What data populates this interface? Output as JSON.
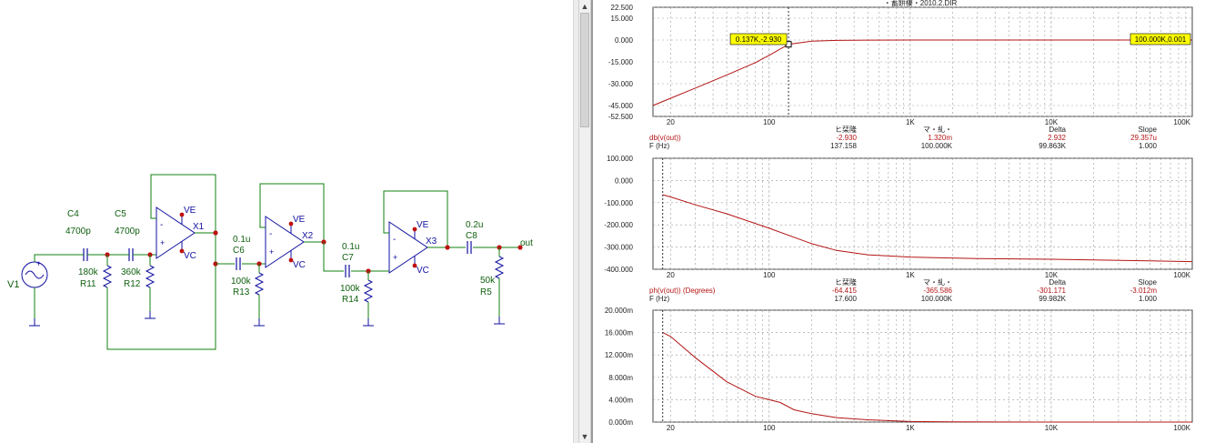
{
  "schematic": {
    "source": "V1",
    "out_label": "out",
    "components": [
      {
        "ref": "C4",
        "value": "4700p"
      },
      {
        "ref": "C5",
        "value": "4700p"
      },
      {
        "ref": "R11",
        "value": "180k"
      },
      {
        "ref": "R12",
        "value": "360k"
      },
      {
        "ref": "C6",
        "value": "0.1u"
      },
      {
        "ref": "R13",
        "value": "100k"
      },
      {
        "ref": "C7",
        "value": "0.1u"
      },
      {
        "ref": "R14",
        "value": "100k"
      },
      {
        "ref": "C8",
        "value": "0.2u"
      },
      {
        "ref": "R5",
        "value": "50k"
      }
    ],
    "opamps": [
      {
        "ref": "X1",
        "vplus": "VE",
        "vminus": "VC"
      },
      {
        "ref": "X2",
        "vplus": "VE",
        "vminus": "VC"
      },
      {
        "ref": "X3",
        "vplus": "VE",
        "vminus": "VC"
      }
    ],
    "pin_minus": "-",
    "pin_plus": "+"
  },
  "plot": {
    "title": "・蓄餅棲・2010.2.DIR",
    "x_ticks": [
      "20",
      "100",
      "1K",
      "10K",
      "100K"
    ],
    "readout_headers": [
      "ヒ栞隆",
      "マ・糺・",
      "Delta",
      "Slope"
    ],
    "colors": {
      "trace": "#b41414",
      "grid": "#9a9a9a",
      "marker": "#ffff00"
    }
  },
  "chart_data": [
    {
      "type": "line",
      "xscale": "log",
      "xlim": [
        15,
        100000
      ],
      "ylim": [
        -52.5,
        22.5
      ],
      "y_ticks": [
        "22.500",
        "15.000",
        "0.000",
        "-15.000",
        "-30.000",
        "-45.000",
        "-52.500"
      ],
      "series": [
        {
          "name": "db(v(out))",
          "color": "#b41414",
          "x": [
            15,
            20,
            30,
            50,
            80,
            100,
            137.158,
            200,
            300,
            500,
            1000,
            10000,
            100000
          ],
          "y": [
            -45,
            -40,
            -33,
            -24,
            -15.5,
            -10.5,
            -2.93,
            -0.8,
            -0.25,
            -0.05,
            0,
            0,
            0.001
          ]
        }
      ],
      "cursor_labels": [
        "0.137K,-2.930",
        "100.000K,0.001"
      ],
      "readout": [
        {
          "label": "db(v(out))",
          "values": [
            "-2.930",
            "1.320m",
            "2.932",
            "29.357u"
          ]
        },
        {
          "label": "F (Hz)",
          "values": [
            "137.158",
            "100.000K",
            "99.863K",
            "1.000"
          ]
        }
      ]
    },
    {
      "type": "line",
      "xscale": "log",
      "xlim": [
        15,
        100000
      ],
      "ylim": [
        -400,
        100
      ],
      "y_ticks": [
        "100.000",
        "0.000",
        "-100.000",
        "-200.000",
        "-300.000",
        "-400.000"
      ],
      "series": [
        {
          "name": "ph(v(out)) (Degrees)",
          "color": "#b41414",
          "x": [
            17.6,
            20,
            30,
            50,
            100,
            200,
            300,
            500,
            1000,
            3000,
            10000,
            100000
          ],
          "y": [
            -64.4,
            -74,
            -110,
            -150,
            -215,
            -285,
            -315,
            -335,
            -345,
            -352,
            -355,
            -365.6
          ]
        }
      ],
      "readout": [
        {
          "label": "ph(v(out)) (Degrees)",
          "values": [
            "-64.415",
            "-365.586",
            "-301.171",
            "-3.012m"
          ]
        },
        {
          "label": "F (Hz)",
          "values": [
            "17.600",
            "100.000K",
            "99.982K",
            "1.000"
          ]
        }
      ]
    },
    {
      "type": "line",
      "xscale": "log",
      "xlim": [
        15,
        100000
      ],
      "ylim": [
        0,
        20
      ],
      "y_ticks": [
        "20.000m",
        "16.000m",
        "12.000m",
        "8.000m",
        "4.000m",
        "0.000m"
      ],
      "series": [
        {
          "name": "",
          "color": "#b41414",
          "x": [
            17.6,
            20,
            30,
            50,
            80,
            100,
            120,
            150,
            200,
            300,
            500,
            1000,
            2000,
            10000,
            100000
          ],
          "y": [
            16,
            15.3,
            11.5,
            7.2,
            4.6,
            4.0,
            3.5,
            2.2,
            1.5,
            0.8,
            0.4,
            0.1,
            0.05,
            0,
            0
          ]
        }
      ]
    }
  ]
}
